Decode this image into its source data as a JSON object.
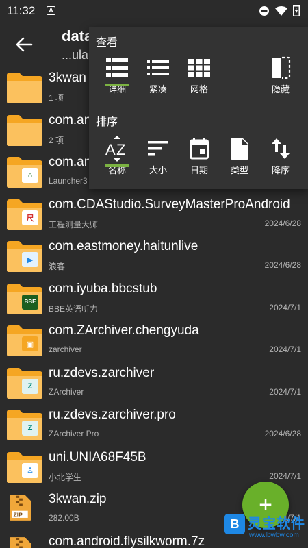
{
  "status": {
    "time": "11:32",
    "a_icon": "A"
  },
  "appbar": {
    "title": "data",
    "subtitle": "...ula"
  },
  "popup": {
    "view_title": "查看",
    "view_options": [
      {
        "label": "详细",
        "icon": "list-detail-icon",
        "selected": true
      },
      {
        "label": "紧凑",
        "icon": "list-compact-icon",
        "selected": false
      },
      {
        "label": "网格",
        "icon": "grid-icon",
        "selected": false
      },
      {
        "label": "隐藏",
        "icon": "hidden-files-icon",
        "selected": false
      }
    ],
    "sort_title": "排序",
    "sort_options": [
      {
        "label": "名称",
        "icon": "sort-az-icon",
        "selected": true
      },
      {
        "label": "大小",
        "icon": "sort-size-icon",
        "selected": false
      },
      {
        "label": "日期",
        "icon": "calendar-icon",
        "selected": false
      },
      {
        "label": "类型",
        "icon": "file-type-icon",
        "selected": false
      },
      {
        "label": "降序",
        "icon": "sort-order-icon",
        "selected": false
      }
    ]
  },
  "files": [
    {
      "name": "3kwan",
      "sub": "1 项",
      "date": "",
      "badge": ""
    },
    {
      "name": "com.an",
      "sub": "2 项",
      "date": "",
      "badge": ""
    },
    {
      "name": "com.an",
      "sub": "Launcher3",
      "date": "",
      "badge": "home"
    },
    {
      "name": "com.CDAStudio.SurveyMasterProAndroid",
      "sub": "工程测量大师",
      "date": "2024/6/28",
      "badge": "尺"
    },
    {
      "name": "com.eastmoney.haitunlive",
      "sub": "浪客",
      "date": "2024/6/28",
      "badge": "▶"
    },
    {
      "name": "com.iyuba.bbcstub",
      "sub": "BBE英语听力",
      "date": "2024/7/1",
      "badge": "BBE"
    },
    {
      "name": "com.ZArchiver.chengyuda",
      "sub": "zarchiver",
      "date": "2024/7/1",
      "badge": "▣"
    },
    {
      "name": "ru.zdevs.zarchiver",
      "sub": "ZArchiver",
      "date": "2024/7/1",
      "badge": "Z"
    },
    {
      "name": "ru.zdevs.zarchiver.pro",
      "sub": "ZArchiver Pro",
      "date": "2024/6/28",
      "badge": "Z"
    },
    {
      "name": "uni.UNIA68F45B",
      "sub": "小北学生",
      "date": "2024/7/1",
      "badge": "♙"
    },
    {
      "name": "3kwan.zip",
      "sub": "282.00B",
      "date": "2024/7/1",
      "badge": "zip"
    },
    {
      "name": "com.android.flysilkworm.7z",
      "sub": "",
      "date": "",
      "badge": "zip"
    }
  ],
  "fab": {
    "label": "+"
  },
  "watermark": {
    "text": "灵宝软件",
    "url": "www.lbwbw.com",
    "letter": "B"
  }
}
